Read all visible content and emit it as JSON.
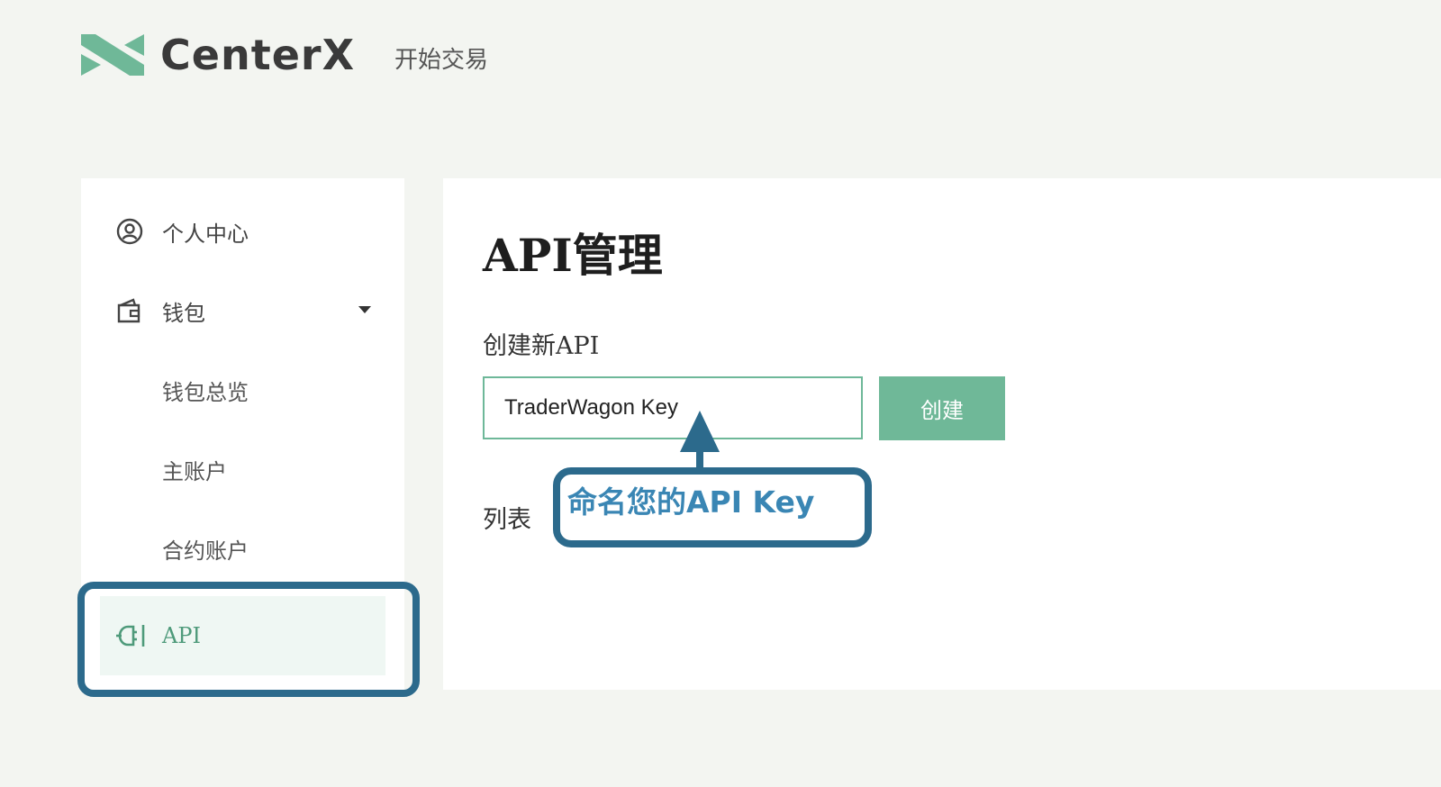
{
  "brand": {
    "name": "CenterX",
    "primary_color": "#6fb898",
    "mark_color": "#6fb898"
  },
  "header": {
    "nav_trade": "开始交易"
  },
  "sidebar": {
    "items": [
      {
        "label": "个人中心",
        "icon": "user-circle-icon"
      },
      {
        "label": "钱包",
        "icon": "wallet-icon",
        "expanded": true
      },
      {
        "label": "钱包总览"
      },
      {
        "label": "主账户"
      },
      {
        "label": "合约账户"
      },
      {
        "label": "API",
        "icon": "plug-icon",
        "active": true
      }
    ]
  },
  "main": {
    "title": "API管理",
    "create_section_label": "创建新API",
    "key_input_value": "TraderWagon Key",
    "create_button": "创建",
    "list_label": "列表"
  },
  "annotation": {
    "callout_text": "命名您的API Key",
    "annotation_color": "#2c6a8c",
    "callout_text_color": "#3a86b4"
  }
}
